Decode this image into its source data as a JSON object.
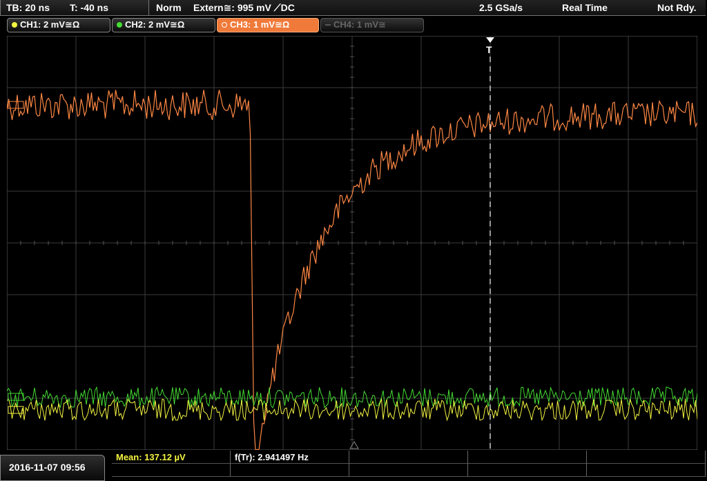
{
  "status_bar": {
    "timebase": "TB: 20 ns",
    "trigger_time": "T: -40 ns",
    "mode": "Norm",
    "trigger_source": "Extern≅: 995 mV ⟋DC",
    "sample_rate": "2.5 GSa/s",
    "acquisition": "Real Time",
    "trigger_status": "Not Rdy."
  },
  "channels": [
    {
      "label": "CH1: 2 mV≅Ω",
      "color": "#f5f542",
      "state": "on"
    },
    {
      "label": "CH2: 2 mV≅Ω",
      "color": "#44dd33",
      "state": "on"
    },
    {
      "label": "CH3: 1 mV≅Ω",
      "color": "#ff8844",
      "state": "selected"
    },
    {
      "label": "CH4: 1 mV≅",
      "color": "#777777",
      "state": "off"
    }
  ],
  "trigger_marker": "T",
  "footer": {
    "datetime": "2016-11-07 09:56",
    "mean": "Mean: 137.12 µV",
    "frequency": "f(Tr): 2.941497 Hz"
  },
  "colors": {
    "ch1": "#f5f542",
    "ch2": "#44dd33",
    "ch3": "#ff8844",
    "grid": "#3c3c3c",
    "background": "#000000"
  }
}
